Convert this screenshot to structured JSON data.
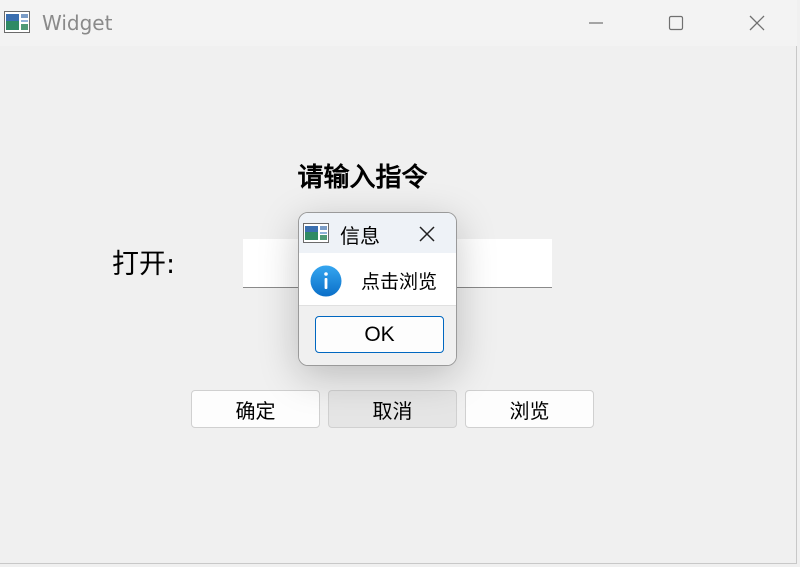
{
  "window": {
    "title": "Widget"
  },
  "main": {
    "heading": "请输入指令",
    "open_label": "打开:",
    "open_value": "",
    "buttons": {
      "confirm": "确定",
      "cancel": "取消",
      "browse": "浏览"
    }
  },
  "dialog": {
    "title": "信息",
    "message": "点击浏览",
    "ok_label": "OK",
    "icon": "info-icon"
  },
  "colors": {
    "info_blue": "#1a8be0",
    "accent": "#0067c0"
  }
}
